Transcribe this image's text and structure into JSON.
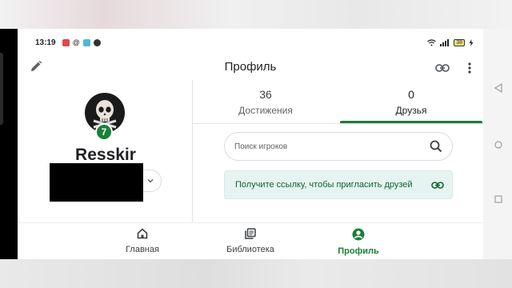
{
  "status_bar": {
    "time": "13:19",
    "battery": "38"
  },
  "app_bar": {
    "title": "Профиль"
  },
  "profile": {
    "username": "Resskir",
    "level": "7"
  },
  "tabs": [
    {
      "count": "36",
      "label": "Достижения",
      "active": false
    },
    {
      "count": "0",
      "label": "Друзья",
      "active": true
    }
  ],
  "search": {
    "placeholder": "Поиск игроков"
  },
  "invite": {
    "text": "Получите ссылку, чтобы пригласить друзей"
  },
  "bottom_nav": [
    {
      "label": "Главная",
      "icon": "home-icon"
    },
    {
      "label": "Библиотека",
      "icon": "library-icon"
    },
    {
      "label": "Профиль",
      "icon": "account-circle-icon",
      "active": true
    }
  ],
  "colors": {
    "accent": "#188038",
    "invite_bg": "#e6f4f1"
  }
}
